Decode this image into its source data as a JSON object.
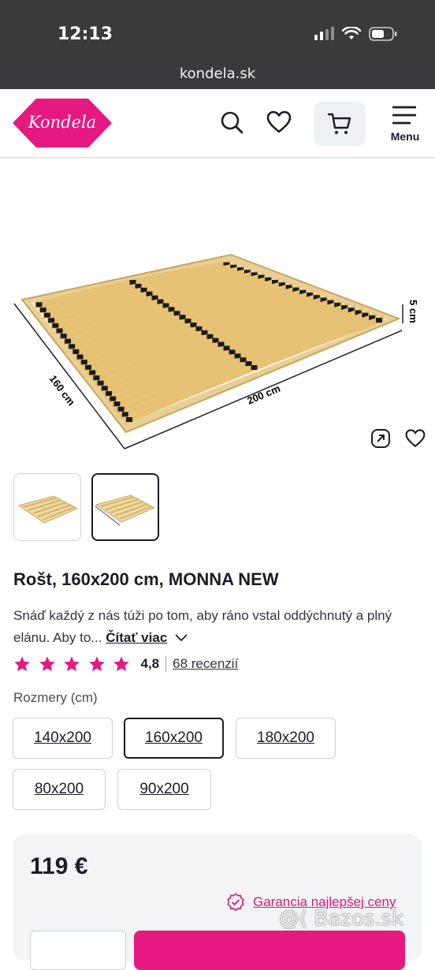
{
  "status_bar": {
    "time": "12:13",
    "url": "kondela.sk"
  },
  "header": {
    "logo_text": "Kondela",
    "menu_label": "Menu",
    "brand_color": "#e5197f"
  },
  "product": {
    "image_labels": {
      "width": "160 cm",
      "length": "200 cm",
      "height": "5 cm"
    },
    "title": "Rošt, 160x200 cm, MONNA NEW",
    "description": "Snáď každý z nás túži po tom, aby ráno vstal oddýchnutý a plný elánu. Aby to...",
    "read_more": "Čítať viac",
    "rating_value": "4,8",
    "rating_stars": 5,
    "reviews": "68 recenzií",
    "sizes_label": "Rozmery (cm)",
    "sizes": [
      "140x200",
      "160x200",
      "180x200",
      "80x200",
      "90x200"
    ],
    "selected_size": "160x200",
    "price": "119 €",
    "guarantee": "Garancia najlepšej ceny"
  },
  "watermark": "@( Bazos.sk"
}
